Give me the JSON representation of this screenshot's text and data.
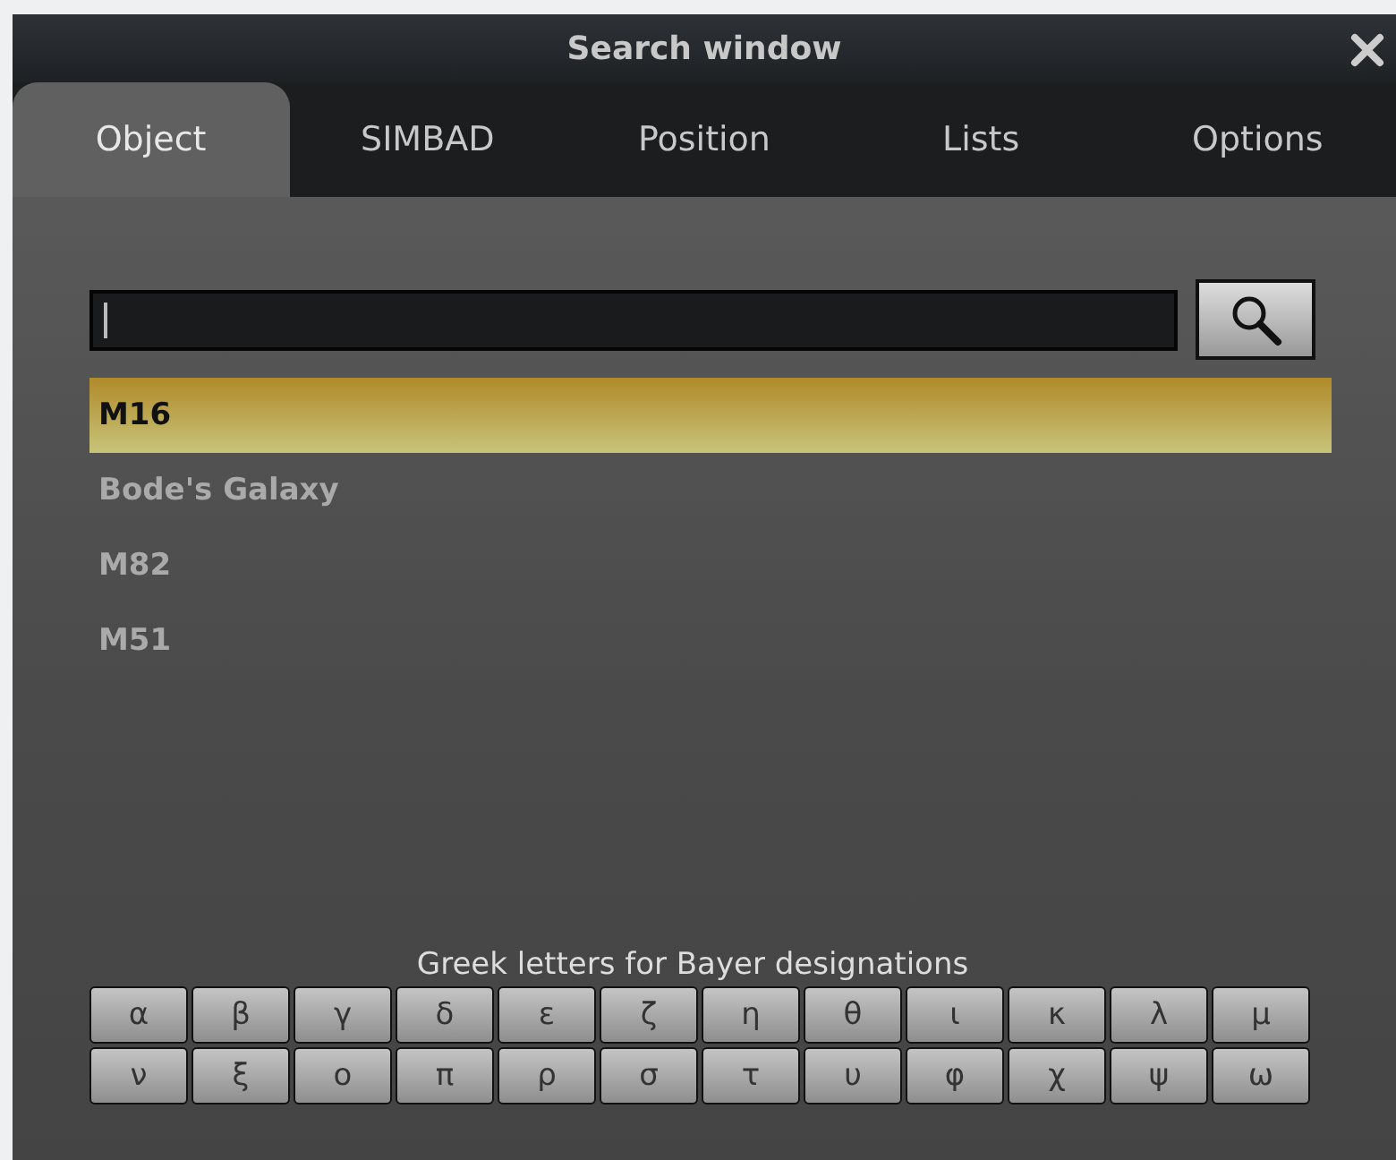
{
  "window": {
    "title": "Search window"
  },
  "tabs": [
    {
      "label": "Object",
      "selected": true
    },
    {
      "label": "SIMBAD",
      "selected": false
    },
    {
      "label": "Position",
      "selected": false
    },
    {
      "label": "Lists",
      "selected": false
    },
    {
      "label": "Options",
      "selected": false
    }
  ],
  "results": [
    {
      "label": "M16",
      "selected": true
    },
    {
      "label": "Bode's Galaxy",
      "selected": false
    },
    {
      "label": "M82",
      "selected": false
    },
    {
      "label": "M51",
      "selected": false
    }
  ],
  "greek": {
    "label": "Greek letters for Bayer designations",
    "keys": [
      "α",
      "β",
      "γ",
      "δ",
      "ε",
      "ζ",
      "η",
      "θ",
      "ι",
      "κ",
      "λ",
      "μ",
      "ν",
      "ξ",
      "ο",
      "π",
      "ρ",
      "σ",
      "τ",
      "υ",
      "φ",
      "χ",
      "ψ",
      "ω"
    ]
  }
}
